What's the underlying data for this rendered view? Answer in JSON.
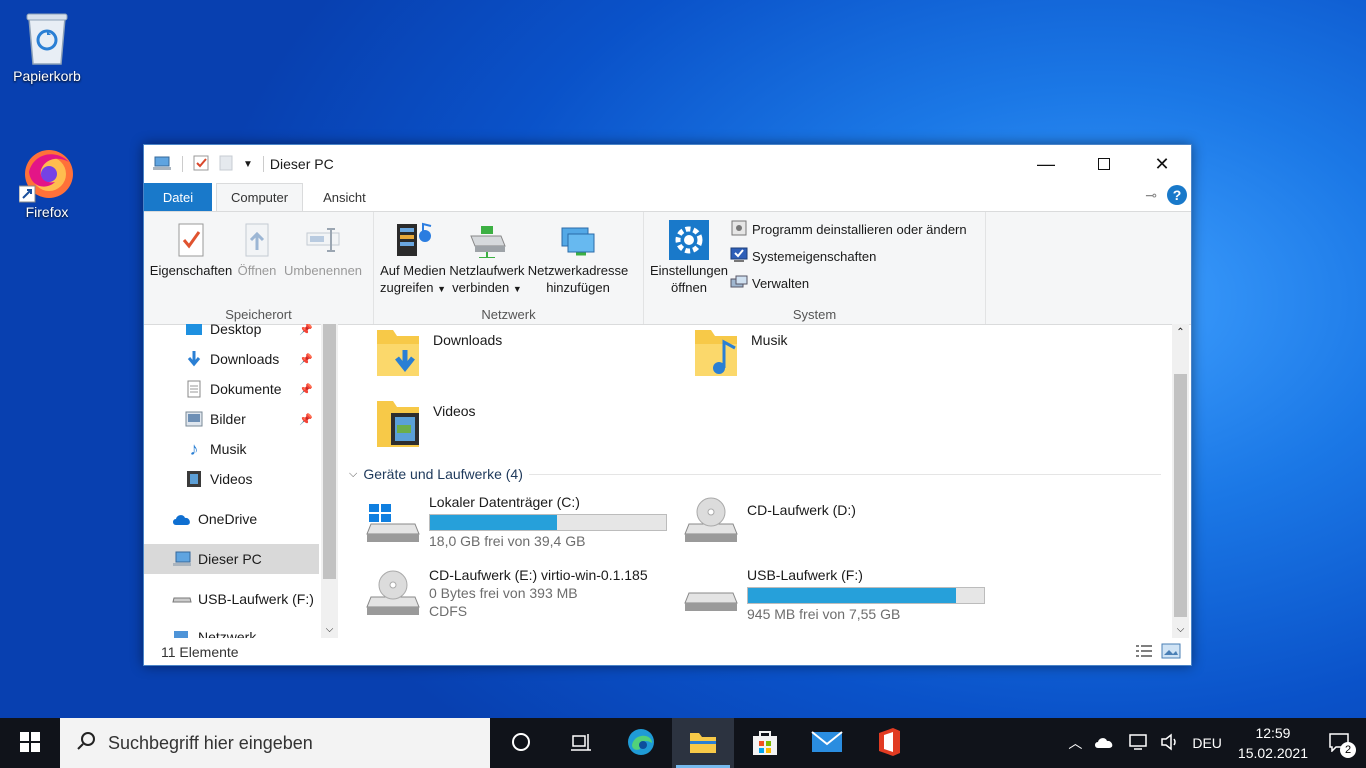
{
  "desktop": {
    "icons": [
      {
        "label": "Papierkorb"
      },
      {
        "label": "Firefox"
      }
    ]
  },
  "window": {
    "title": "Dieser PC",
    "tabs": {
      "file": "Datei",
      "computer": "Computer",
      "view": "Ansicht"
    },
    "ribbon": {
      "location": {
        "label": "Speicherort",
        "properties": "Eigenschaften",
        "open": "Öffnen",
        "rename": "Umbenennen"
      },
      "network": {
        "label": "Netzwerk",
        "media_line1": "Auf Medien",
        "media_line2": "zugreifen",
        "map_line1": "Netzlaufwerk",
        "map_line2": "verbinden",
        "addr_line1": "Netzwerkadresse",
        "addr_line2": "hinzufügen"
      },
      "system": {
        "label": "System",
        "settings_line1": "Einstellungen",
        "settings_line2": "öffnen",
        "uninstall": "Programm deinstallieren oder ändern",
        "sysprops": "Systemeigenschaften",
        "manage": "Verwalten"
      }
    },
    "nav": {
      "items": [
        {
          "label": "Desktop"
        },
        {
          "label": "Downloads"
        },
        {
          "label": "Dokumente"
        },
        {
          "label": "Bilder"
        },
        {
          "label": "Musik"
        },
        {
          "label": "Videos"
        },
        {
          "label": "OneDrive"
        },
        {
          "label": "Dieser PC"
        },
        {
          "label": "USB-Laufwerk (F:)"
        },
        {
          "label": "Netzwerk"
        }
      ]
    },
    "content": {
      "folders": [
        {
          "name": "Downloads"
        },
        {
          "name": "Musik"
        },
        {
          "name": "Videos"
        }
      ],
      "devices_header": "Geräte und Laufwerke (4)",
      "drives": [
        {
          "name": "Lokaler Datenträger (C:)",
          "free": "18,0 GB frei von 39,4 GB",
          "used_fraction": 0.54
        },
        {
          "name": "CD-Laufwerk (D:)"
        },
        {
          "name": "CD-Laufwerk (E:) virtio-win-0.1.185",
          "free": "0 Bytes frei von 393 MB",
          "fs": "CDFS"
        },
        {
          "name": "USB-Laufwerk (F:)",
          "free": "945 MB frei von 7,55 GB",
          "used_fraction": 0.88
        }
      ]
    },
    "status": "11 Elemente"
  },
  "taskbar": {
    "search_placeholder": "Suchbegriff hier eingeben",
    "language": "DEU",
    "time": "12:59",
    "date": "15.02.2021",
    "notifications": "2"
  },
  "colors": {
    "accent": "#1979ca",
    "bar_fill": "#26a0da",
    "taskbar": "#10131a"
  }
}
